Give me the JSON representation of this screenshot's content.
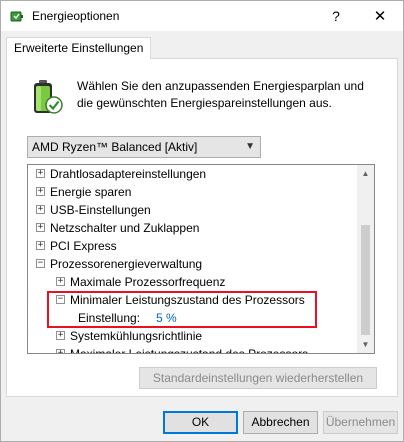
{
  "window": {
    "title": "Energieoptionen",
    "help_label": "?",
    "close_label": "✕"
  },
  "tab": {
    "label": "Erweiterte Einstellungen"
  },
  "intro_text": "Wählen Sie den anzupassenden Energiesparplan und die gewünschten Energiespareinstellungen aus.",
  "plan_select": {
    "value": "AMD Ryzen™ Balanced [Aktiv]"
  },
  "tree": {
    "items": [
      {
        "label": "Drahtlosadaptereinstellungen",
        "expander": "+"
      },
      {
        "label": "Energie sparen",
        "expander": "+"
      },
      {
        "label": "USB-Einstellungen",
        "expander": "+"
      },
      {
        "label": "Netzschalter und Zuklappen",
        "expander": "+"
      },
      {
        "label": "PCI Express",
        "expander": "+"
      },
      {
        "label": "Prozessorenergieverwaltung",
        "expander": "−"
      },
      {
        "label": "Maximale Prozessorfrequenz",
        "expander": "+"
      },
      {
        "label": "Minimaler Leistungszustand des Prozessors",
        "expander": "−"
      },
      {
        "label": "Einstellung:",
        "value": "5 %"
      },
      {
        "label": "Systemkühlungsrichtlinie",
        "expander": "+"
      },
      {
        "label": "Maximaler Leistungszustand des Prozessors",
        "expander": "+"
      }
    ]
  },
  "restore_button": {
    "label": "Standardeinstellungen wiederherstellen"
  },
  "buttons": {
    "ok": "OK",
    "cancel": "Abbrechen",
    "apply": "Übernehmen"
  },
  "colors": {
    "highlight": "#e81123",
    "link": "#0066cc",
    "accent": "#0078d7"
  },
  "icons": {
    "app": "power-options-icon",
    "battery": "battery-check-icon"
  }
}
